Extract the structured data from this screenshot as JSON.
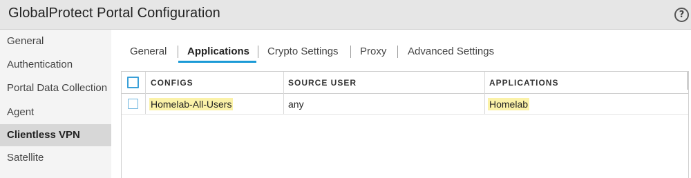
{
  "window": {
    "title": "GlobalProtect Portal Configuration",
    "help_icon": "?"
  },
  "sidebar": {
    "items": [
      {
        "label": "General"
      },
      {
        "label": "Authentication"
      },
      {
        "label": "Portal Data Collection"
      },
      {
        "label": "Agent"
      },
      {
        "label": "Clientless VPN",
        "active": true
      },
      {
        "label": "Satellite"
      }
    ]
  },
  "tabs": [
    {
      "label": "General"
    },
    {
      "label": "Applications",
      "active": true
    },
    {
      "label": "Crypto Settings"
    },
    {
      "label": "Proxy"
    },
    {
      "label": "Advanced Settings"
    }
  ],
  "table": {
    "columns": [
      "CONFIGS",
      "SOURCE USER",
      "APPLICATIONS"
    ],
    "rows": [
      {
        "configs": "Homelab-All-Users",
        "source_user": "any",
        "applications": "Homelab"
      }
    ]
  },
  "colors": {
    "accent": "#1b9ad6",
    "highlight": "#fbf2a8",
    "active_sidebar": "#d7d7d7"
  }
}
